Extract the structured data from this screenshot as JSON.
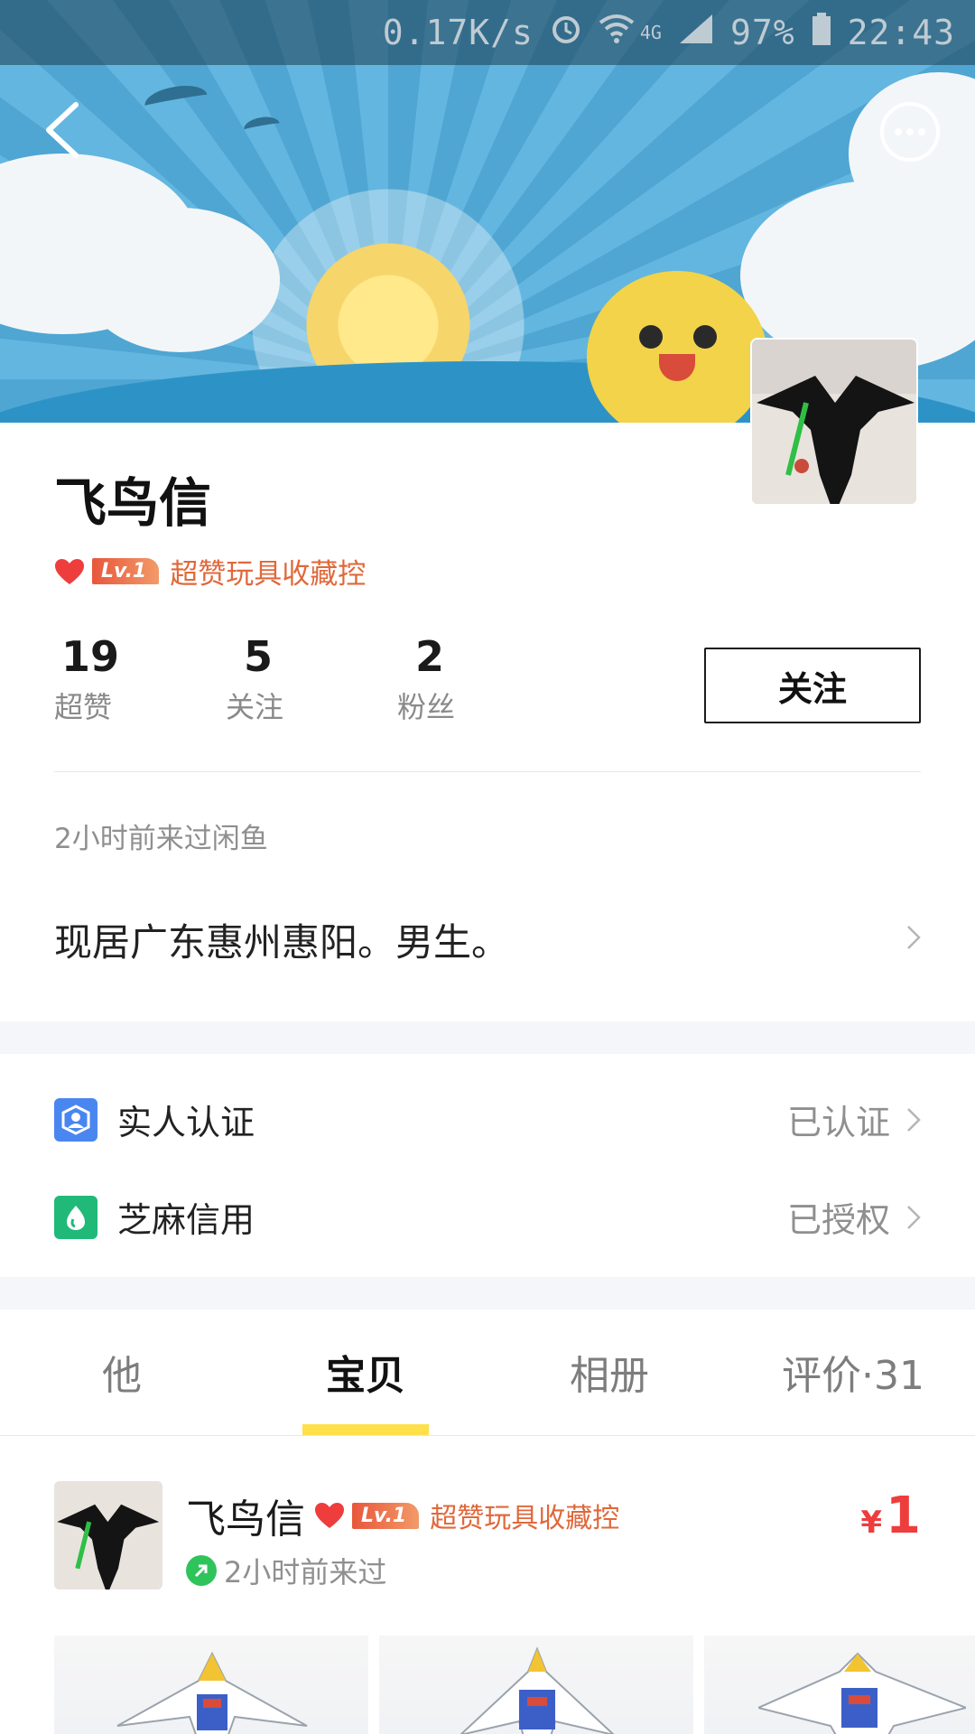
{
  "status_bar": {
    "speed": "0.17K/s",
    "network": "4G",
    "battery": "97%",
    "time": "22:43",
    "icons": [
      "alarm-icon",
      "wifi-icon",
      "signal-icon",
      "battery-icon"
    ]
  },
  "header": {
    "back_icon": "chevron-left-icon",
    "more_icon": "more-dots-icon"
  },
  "profile": {
    "name": "飞鸟信",
    "level": "Lv.1",
    "badge_text": "超赞玩具收藏控",
    "stats": [
      {
        "value": "19",
        "label": "超赞"
      },
      {
        "value": "5",
        "label": "关注"
      },
      {
        "value": "2",
        "label": "粉丝"
      }
    ],
    "follow_label": "关注",
    "last_seen": "2小时前来过闲鱼",
    "bio": "现居广东惠州惠阳。男生。"
  },
  "verification": [
    {
      "label": "实人认证",
      "status": "已认证",
      "icon": "person-verify-icon",
      "color": "#4a86f0"
    },
    {
      "label": "芝麻信用",
      "status": "已授权",
      "icon": "sesame-credit-icon",
      "color": "#20b978"
    }
  ],
  "tabs": [
    {
      "label": "他",
      "active": false
    },
    {
      "label": "宝贝",
      "active": true
    },
    {
      "label": "相册",
      "active": false
    },
    {
      "label": "评价·31",
      "active": false
    }
  ],
  "item": {
    "seller_name": "飞鸟信",
    "level": "Lv.1",
    "badge_text": "超赞玩具收藏控",
    "last_seen": "2小时前来过",
    "currency": "¥",
    "price": "1"
  },
  "colors": {
    "accent_yellow": "#ffe04a",
    "price_red": "#ee3d3d",
    "badge_orange": "#e0683b"
  }
}
